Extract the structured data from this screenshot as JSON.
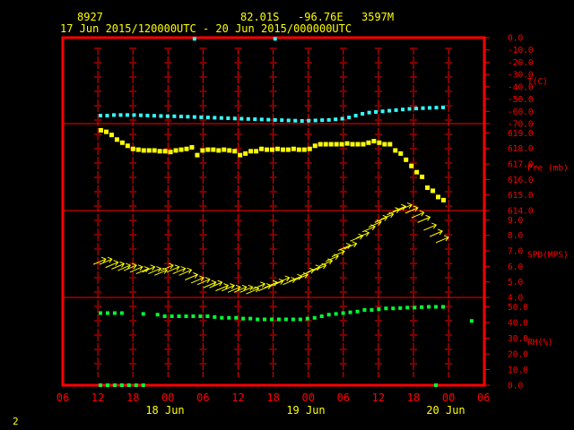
{
  "header": {
    "station_id": "8927",
    "latitude": "82.01S",
    "longitude": "-96.76E",
    "elevation": "3597M",
    "period": "17 Jun 2015/120000UTC - 20 Jun 2015/000000UTC"
  },
  "footer": {
    "page_number": "2"
  },
  "chart_data": [
    {
      "type": "scatter",
      "panel": "temperature",
      "ylabel": "T(C)",
      "yticks": [
        "0.0",
        "-10.0",
        "-20.0",
        "-30.0",
        "-40.0",
        "-50.0",
        "-60.0",
        "-70.0"
      ],
      "ylim": [
        -70,
        0
      ],
      "color": "#33ffff",
      "x": [
        0,
        1,
        2,
        3,
        4,
        5,
        6,
        7,
        8,
        9,
        10,
        11,
        12,
        13,
        14,
        15,
        16,
        17,
        18,
        19,
        20,
        21,
        22,
        23,
        24,
        25,
        26,
        27,
        28,
        29,
        30,
        31,
        32,
        33,
        34,
        35,
        36,
        37,
        38,
        39,
        40,
        41,
        42,
        43,
        44,
        45,
        46,
        47,
        48,
        49,
        50,
        51,
        52,
        53,
        54,
        55,
        56,
        57,
        58,
        59,
        60
      ],
      "values": [
        -63.5,
        -63.5,
        -63,
        -63,
        -63,
        -63,
        -63.2,
        -63.4,
        -63.6,
        -63.8,
        -64,
        -64,
        -64.2,
        -64.4,
        -64.6,
        -64.8,
        -65,
        -65.2,
        -65.4,
        -65.6,
        -65.8,
        -66,
        -66.2,
        -66.4,
        -66.6,
        -66.8,
        -67,
        -67.2,
        -67.4,
        -67.6,
        -67.8,
        -67.6,
        -67.4,
        -67.2,
        -67,
        -66.5,
        -66,
        -65,
        -63.5,
        -62,
        -61,
        -60.5,
        -60,
        -59.5,
        -59,
        -58.5,
        -58,
        -57.7,
        -57.4,
        -57.2,
        -57,
        -56.8
      ],
      "outliers": [
        {
          "x": 14,
          "value": -1
        },
        {
          "x": 26,
          "value": -1
        }
      ]
    },
    {
      "type": "scatter",
      "panel": "pressure",
      "ylabel": "Pre (mb)",
      "yticks": [
        "619.0",
        "618.0",
        "617.0",
        "616.0",
        "615.0",
        "614.0"
      ],
      "ylim": [
        614,
        619.6
      ],
      "color": "#ffff00",
      "x": [
        0,
        1,
        2,
        3,
        4,
        5,
        6,
        7,
        8,
        9,
        10,
        11,
        12,
        13,
        14,
        15,
        16,
        17,
        18,
        19,
        20,
        21,
        22,
        23,
        24,
        25,
        26,
        27,
        28,
        29,
        30,
        31,
        32,
        33,
        34,
        35,
        36,
        37,
        38,
        39,
        40,
        41,
        42,
        43,
        44,
        45,
        46,
        47,
        48,
        49,
        50,
        51,
        52,
        53,
        54,
        55,
        56,
        57,
        58,
        59,
        60
      ],
      "values": [
        619.2,
        619.1,
        618.9,
        618.6,
        618.4,
        618.2,
        618.0,
        617.95,
        617.9,
        617.9,
        617.9,
        617.85,
        617.85,
        617.8,
        617.9,
        617.95,
        618.0,
        618.1,
        617.6,
        617.9,
        617.95,
        617.95,
        617.9,
        617.95,
        617.9,
        617.85,
        617.6,
        617.7,
        617.85,
        617.85,
        618.0,
        617.95,
        617.95,
        618.0,
        617.95,
        617.95,
        618.0,
        617.95,
        617.95,
        618.0,
        618.2,
        618.3,
        618.3,
        618.3,
        618.3,
        618.3,
        618.35,
        618.3,
        618.3,
        618.3,
        618.4,
        618.5,
        618.4,
        618.3,
        618.3,
        617.9,
        617.7,
        617.3,
        616.9,
        616.5,
        616.2,
        615.5,
        615.3,
        614.9,
        614.7
      ],
      "scale": "0.2 mb per point"
    },
    {
      "type": "scatter",
      "panel": "wind",
      "ylabel": "SPD(MPS)",
      "yticks": [
        "9.0",
        "8.0",
        "7.0",
        "6.0",
        "5.0",
        "4.0"
      ],
      "ylim": [
        4,
        9.6
      ],
      "color": "#ffff00",
      "x": [
        0,
        1,
        2,
        3,
        4,
        5,
        6,
        7,
        8,
        9,
        10,
        11,
        12,
        13,
        14,
        15,
        16,
        17,
        18,
        19,
        20,
        21,
        22,
        23,
        24,
        25,
        26,
        27,
        28,
        29,
        30,
        31,
        32,
        33,
        34,
        35,
        36,
        37,
        38,
        39,
        40,
        41,
        42,
        43,
        44,
        45,
        46,
        47,
        48,
        49,
        50,
        51,
        52,
        53,
        54,
        55,
        56,
        57,
        58,
        59,
        60
      ],
      "values": [
        6.3,
        6.3,
        6.1,
        6.0,
        5.9,
        5.9,
        5.8,
        5.7,
        5.8,
        5.7,
        5.6,
        5.9,
        5.8,
        5.7,
        5.6,
        5.3,
        5.1,
        5.0,
        4.8,
        4.8,
        4.6,
        4.6,
        4.5,
        4.5,
        4.5,
        4.4,
        4.7,
        4.6,
        4.8,
        4.9,
        5.1,
        5.0,
        5.2,
        5.3,
        5.6,
        5.8,
        5.9,
        6.2,
        6.5,
        6.8,
        7.2,
        7.3,
        7.8,
        8.0,
        8.4,
        8.7,
        9.0,
        9.2,
        9.5,
        9.7,
        9.8,
        9.6,
        9.3,
        9.0,
        8.5,
        8.1,
        7.7
      ]
    },
    {
      "type": "scatter",
      "panel": "relative_humidity",
      "ylabel": "RH(%)",
      "yticks": [
        "50.0",
        "40.0",
        "30.0",
        "20.0",
        "10.0",
        "0.0"
      ],
      "ylim": [
        0,
        56
      ],
      "color": "#00ff33",
      "x": [
        0,
        1,
        2,
        3,
        4,
        5,
        6,
        7,
        8,
        9,
        10,
        11,
        12,
        13,
        14,
        15,
        16,
        17,
        18,
        19,
        20,
        21,
        22,
        23,
        24,
        25,
        26,
        27,
        28,
        29,
        30,
        31,
        32,
        33,
        34,
        35,
        36,
        37,
        38,
        39,
        40,
        41,
        42,
        43,
        44,
        45,
        46,
        47,
        48,
        49,
        50,
        51,
        52,
        53,
        54,
        55,
        56,
        57,
        58,
        59,
        60
      ],
      "values": [
        46,
        46,
        46,
        46,
        null,
        null,
        45.5,
        null,
        45,
        44,
        44,
        44,
        44,
        44,
        44,
        44,
        43.5,
        43,
        43,
        43,
        42.5,
        42.5,
        42,
        42,
        42,
        42,
        42,
        42,
        42,
        42.5,
        43,
        44,
        45,
        45.5,
        46,
        46.5,
        47,
        48,
        48,
        48.5,
        49,
        49,
        49.2,
        49.5,
        49.5,
        49.8,
        50,
        50,
        50
      ],
      "outliers": [
        {
          "x": 52,
          "value": 41
        },
        {
          "x": 0,
          "value": 0
        },
        {
          "x": 1,
          "value": 0
        },
        {
          "x": 2,
          "value": 0
        },
        {
          "x": 3,
          "value": 0
        },
        {
          "x": 4,
          "value": 0
        },
        {
          "x": 5,
          "value": 0
        },
        {
          "x": 6,
          "value": 0
        },
        {
          "x": 47,
          "value": 0
        }
      ]
    }
  ],
  "x_axis": {
    "ticks": [
      "06",
      "12",
      "18",
      "00",
      "06",
      "12",
      "18",
      "00",
      "06",
      "12",
      "18",
      "00",
      "06"
    ],
    "days": [
      "18 Jun",
      "19 Jun",
      "20 Jun"
    ]
  }
}
